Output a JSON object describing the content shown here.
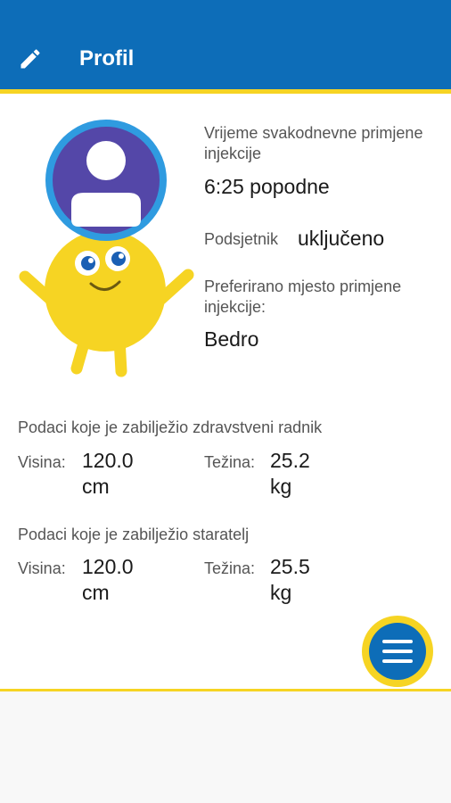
{
  "appbar": {
    "title": "Profil",
    "edit_icon": "pencil-icon",
    "background": "#0d6db8",
    "accent": "#f6d423"
  },
  "injection": {
    "time_label": "Vrijeme svakodnevne primjene injekcije",
    "time_value": "6:25 popodne",
    "reminder_label": "Podsjetnik",
    "reminder_value": "uključeno",
    "site_label": "Preferirano mjesto primjene injekcije:",
    "site_value": "Bedro"
  },
  "health_worker": {
    "heading": "Podaci koje je zabilježio zdravstveni radnik",
    "height_label": "Visina:",
    "height_value": "120.0",
    "height_unit": "cm",
    "weight_label": "Težina:",
    "weight_value": "25.2",
    "weight_unit": "kg"
  },
  "guardian": {
    "heading": "Podaci koje je zabilježio staratelj",
    "height_label": "Visina:",
    "height_value": "120.0",
    "height_unit": "cm",
    "weight_label": "Težina:",
    "weight_value": "25.5",
    "weight_unit": "kg"
  },
  "fab": {
    "icon": "menu-icon"
  }
}
